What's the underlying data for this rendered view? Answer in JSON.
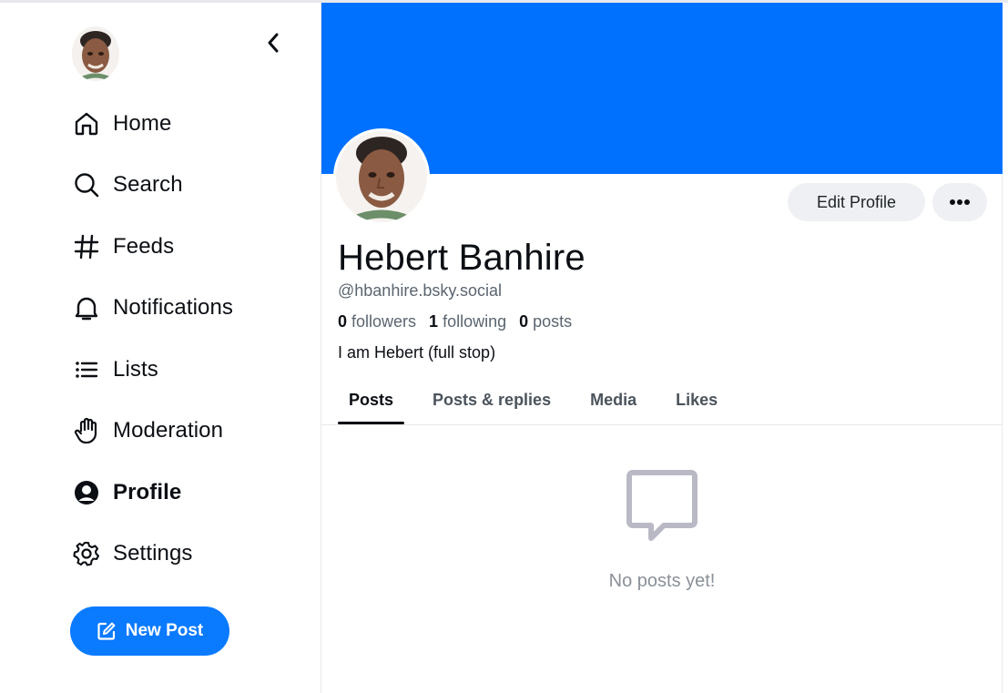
{
  "sidebar": {
    "items": [
      {
        "label": "Home",
        "icon": "home-icon"
      },
      {
        "label": "Search",
        "icon": "search-icon"
      },
      {
        "label": "Feeds",
        "icon": "hash-icon"
      },
      {
        "label": "Notifications",
        "icon": "bell-icon"
      },
      {
        "label": "Lists",
        "icon": "list-icon"
      },
      {
        "label": "Moderation",
        "icon": "hand-icon"
      },
      {
        "label": "Profile",
        "icon": "user-circle-icon",
        "active": true
      },
      {
        "label": "Settings",
        "icon": "gear-icon"
      }
    ],
    "new_post_label": "New Post"
  },
  "profile": {
    "display_name": "Hebert Banhire",
    "handle": "@hbanhire.bsky.social",
    "followers_count": "0",
    "followers_label": "followers",
    "following_count": "1",
    "following_label": "following",
    "posts_count": "0",
    "posts_label": "posts",
    "bio": "I am Hebert (full stop)",
    "edit_profile_label": "Edit Profile"
  },
  "tabs": [
    {
      "label": "Posts",
      "active": true
    },
    {
      "label": "Posts & replies"
    },
    {
      "label": "Media"
    },
    {
      "label": "Likes"
    }
  ],
  "feed": {
    "empty_message": "No posts yet!",
    "empty_icon": "message-bubble-icon"
  },
  "colors": {
    "accent": "#0a7aff",
    "banner": "#0070ff",
    "muted": "#5b6570"
  }
}
